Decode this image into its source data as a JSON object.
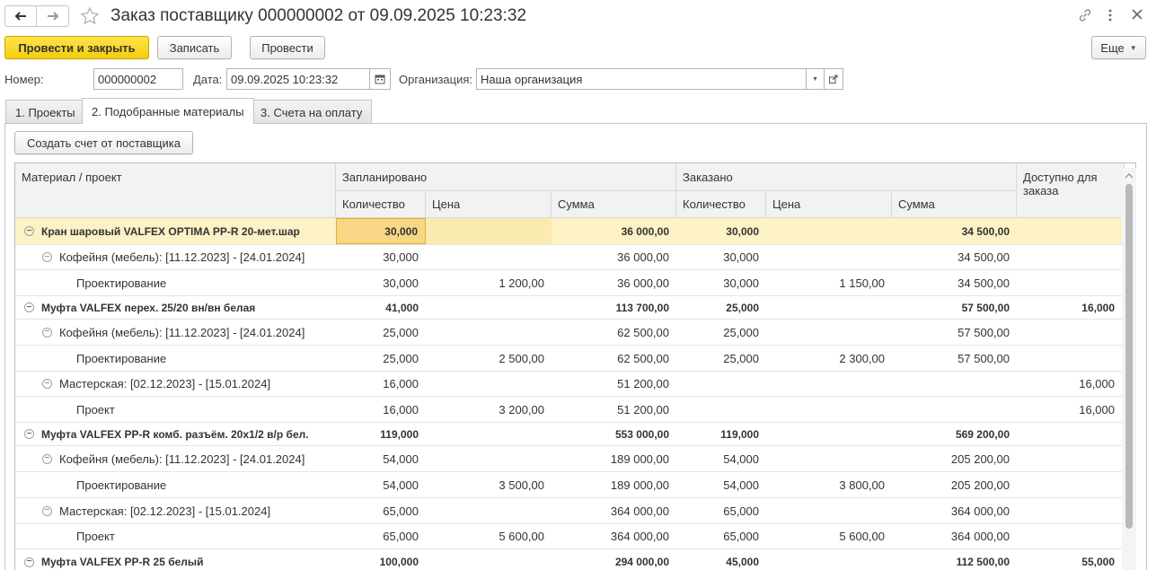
{
  "window": {
    "title": "Заказ поставщику 000000002 от 09.09.2025 10:23:32",
    "back_icon": "arrow-left-icon",
    "forward_icon": "arrow-right-icon",
    "favorite_icon": "star-icon",
    "link_icon": "link-icon",
    "more_icon": "kebab-icon",
    "close_icon": "close-icon"
  },
  "toolbar": {
    "post_close_label": "Провести и закрыть",
    "save_label": "Записать",
    "post_label": "Провести",
    "more_label": "Еще"
  },
  "header_fields": {
    "number_label": "Номер:",
    "number_value": "000000002",
    "date_label": "Дата:",
    "date_value": "09.09.2025 10:23:32",
    "org_label": "Организация:",
    "org_value": "Наша организация"
  },
  "tabs": [
    {
      "label": "1. Проекты"
    },
    {
      "label": "2. Подобранные материалы"
    },
    {
      "label": "3. Счета на оплату"
    }
  ],
  "create_invoice_label": "Создать счет от поставщика",
  "grid": {
    "col_material": "Материал / проект",
    "group_planned": "Запланировано",
    "group_ordered": "Заказано",
    "col_available": "Доступно для заказа",
    "col_qty": "Количество",
    "col_price": "Цена",
    "col_sum": "Сумма",
    "rows": [
      {
        "level": 0,
        "name": "Кран шаровый VALFEX OPTIMA PP-R 20-мет.шар",
        "p_qty": "30,000",
        "p_price": "",
        "p_sum": "36 000,00",
        "o_qty": "30,000",
        "o_price": "",
        "o_sum": "34 500,00",
        "avail": "",
        "selected": true
      },
      {
        "level": 1,
        "name": "Кофейня (мебель): [11.12.2023] - [24.01.2024]",
        "p_qty": "30,000",
        "p_price": "",
        "p_sum": "36 000,00",
        "o_qty": "30,000",
        "o_price": "",
        "o_sum": "34 500,00",
        "avail": ""
      },
      {
        "level": 2,
        "name": "Проектирование",
        "p_qty": "30,000",
        "p_price": "1 200,00",
        "p_sum": "36 000,00",
        "o_qty": "30,000",
        "o_price": "1 150,00",
        "o_sum": "34 500,00",
        "avail": ""
      },
      {
        "level": 0,
        "name": "Муфта VALFEX перех. 25/20 вн/вн белая",
        "p_qty": "41,000",
        "p_price": "",
        "p_sum": "113 700,00",
        "o_qty": "25,000",
        "o_price": "",
        "o_sum": "57 500,00",
        "avail": "16,000"
      },
      {
        "level": 1,
        "name": "Кофейня (мебель): [11.12.2023] - [24.01.2024]",
        "p_qty": "25,000",
        "p_price": "",
        "p_sum": "62 500,00",
        "o_qty": "25,000",
        "o_price": "",
        "o_sum": "57 500,00",
        "avail": ""
      },
      {
        "level": 2,
        "name": "Проектирование",
        "p_qty": "25,000",
        "p_price": "2 500,00",
        "p_sum": "62 500,00",
        "o_qty": "25,000",
        "o_price": "2 300,00",
        "o_sum": "57 500,00",
        "avail": ""
      },
      {
        "level": 1,
        "name": "Мастерская: [02.12.2023] - [15.01.2024]",
        "p_qty": "16,000",
        "p_price": "",
        "p_sum": "51 200,00",
        "o_qty": "",
        "o_price": "",
        "o_sum": "",
        "avail": "16,000"
      },
      {
        "level": 2,
        "name": "Проект",
        "p_qty": "16,000",
        "p_price": "3 200,00",
        "p_sum": "51 200,00",
        "o_qty": "",
        "o_price": "",
        "o_sum": "",
        "avail": "16,000"
      },
      {
        "level": 0,
        "name": "Муфта VALFEX PP-R комб. разъём. 20х1/2 в/р бел.",
        "p_qty": "119,000",
        "p_price": "",
        "p_sum": "553 000,00",
        "o_qty": "119,000",
        "o_price": "",
        "o_sum": "569 200,00",
        "avail": ""
      },
      {
        "level": 1,
        "name": "Кофейня (мебель): [11.12.2023] - [24.01.2024]",
        "p_qty": "54,000",
        "p_price": "",
        "p_sum": "189 000,00",
        "o_qty": "54,000",
        "o_price": "",
        "o_sum": "205 200,00",
        "avail": ""
      },
      {
        "level": 2,
        "name": "Проектирование",
        "p_qty": "54,000",
        "p_price": "3 500,00",
        "p_sum": "189 000,00",
        "o_qty": "54,000",
        "o_price": "3 800,00",
        "o_sum": "205 200,00",
        "avail": ""
      },
      {
        "level": 1,
        "name": "Мастерская: [02.12.2023] - [15.01.2024]",
        "p_qty": "65,000",
        "p_price": "",
        "p_sum": "364 000,00",
        "o_qty": "65,000",
        "o_price": "",
        "o_sum": "364 000,00",
        "avail": ""
      },
      {
        "level": 2,
        "name": "Проект",
        "p_qty": "65,000",
        "p_price": "5 600,00",
        "p_sum": "364 000,00",
        "o_qty": "65,000",
        "o_price": "5 600,00",
        "o_sum": "364 000,00",
        "avail": ""
      },
      {
        "level": 0,
        "name": "Муфта VALFEX PP-R 25 белый",
        "p_qty": "100,000",
        "p_price": "",
        "p_sum": "294 000,00",
        "o_qty": "45,000",
        "o_price": "",
        "o_sum": "112 500,00",
        "avail": "55,000"
      }
    ]
  }
}
